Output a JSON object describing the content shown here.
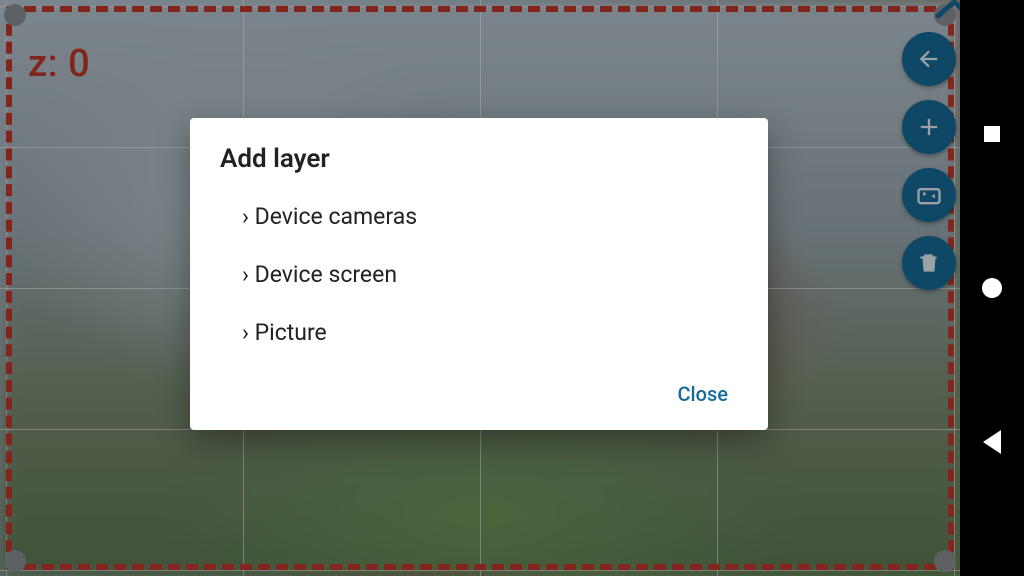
{
  "z_label": "z: 0",
  "fabs": {
    "back": "back-arrow-icon",
    "add": "plus-icon",
    "swap_camera": "swap-camera-icon",
    "delete": "trash-icon"
  },
  "dialog": {
    "title": "Add layer",
    "options": [
      {
        "label": "Device cameras"
      },
      {
        "label": "Device screen"
      },
      {
        "label": "Picture"
      }
    ],
    "close_label": "Close"
  },
  "colors": {
    "fab": "#176a99",
    "selection_border": "#c0392b",
    "dialog_action": "#176a99"
  }
}
